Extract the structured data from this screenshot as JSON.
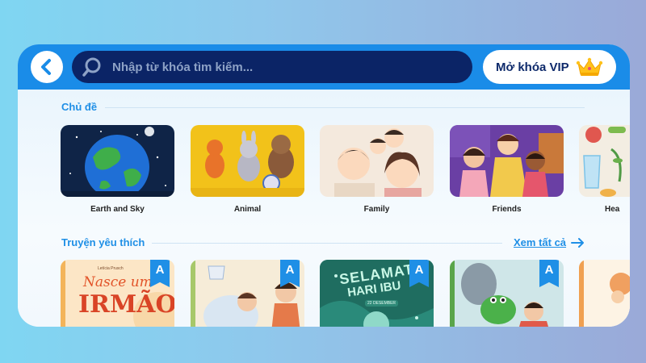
{
  "search": {
    "placeholder": "Nhập từ khóa tìm kiếm..."
  },
  "vip": {
    "label": "Mở khóa VIP"
  },
  "topics": {
    "title": "Chủ đề",
    "items": [
      {
        "label": "Earth and Sky"
      },
      {
        "label": "Animal"
      },
      {
        "label": "Family"
      },
      {
        "label": "Friends"
      },
      {
        "label": "Hea"
      }
    ]
  },
  "favorites": {
    "title": "Truyện yêu thích",
    "see_all": "Xem tất cả",
    "badge": "A",
    "books": [
      {
        "cover_text_top": "Nasce um",
        "cover_text_main": "IRMÃO",
        "cover_author": "Letícia Prusch"
      },
      {
        "cover_text_top": "",
        "cover_text_main": "",
        "cover_author": ""
      },
      {
        "cover_text_top": "SELAMAT",
        "cover_text_main": "HARI IBU",
        "cover_author": "22 DESEMBER"
      },
      {
        "cover_text_top": "",
        "cover_text_main": "",
        "cover_author": ""
      }
    ]
  },
  "colors": {
    "primary": "#1a8ce8",
    "search_bg": "#0b2466",
    "accent_text": "#1f8fe6"
  },
  "icons": {
    "back": "chevron-left-icon",
    "search": "magnifier-icon",
    "vip": "crown-icon",
    "see_all": "arrow-right-icon"
  }
}
